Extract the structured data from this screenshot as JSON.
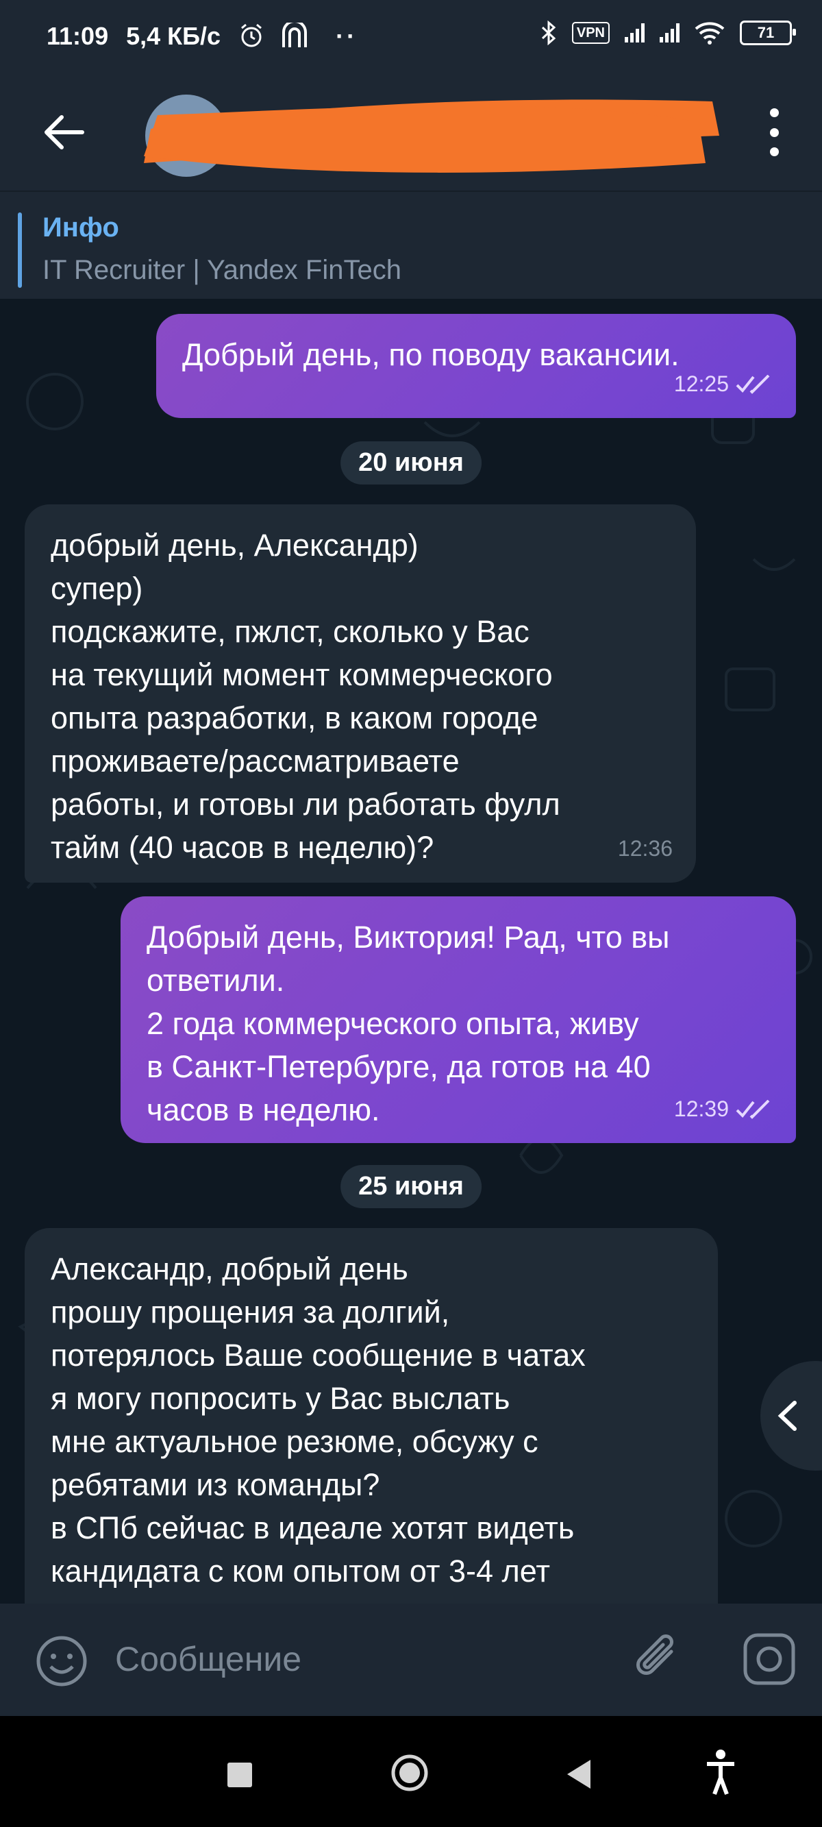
{
  "status_bar": {
    "time": "11:09",
    "speed": "5,4 КБ/с",
    "vpn": "VPN",
    "battery": "71"
  },
  "header": {
    "contact_name_redacted": ""
  },
  "pinned": {
    "title": "Инфо",
    "subtitle": "IT Recruiter | Yandex FinTech"
  },
  "messages": [
    {
      "type": "out",
      "text": "Добрый день, по поводу вакансии.",
      "time": "12:25"
    },
    {
      "type": "date",
      "text": "20 июня"
    },
    {
      "type": "in",
      "text": "добрый день, Александр)\nсупер)\nподскажите, пжлст, сколько у Вас\nна текущий момент коммерческого\nопыта разработки, в каком городе\nпроживаете/рассматриваете\nработы, и готовы ли работать фулл\nтайм (40 часов в неделю)?",
      "time": "12:36"
    },
    {
      "type": "out",
      "text": "Добрый день, Виктория! Рад, что вы\nответили.\n2 года коммерческого опыта, живу\nв Санкт-Петербурге, да готов на 40\nчасов в неделю.",
      "time": "12:39"
    },
    {
      "type": "date",
      "text": "25 июня"
    },
    {
      "type": "in",
      "text": "Александр, добрый день\nпрошу прощения за долгий,\nпотерялось Ваше сообщение в чатах\nя могу попросить у Вас выслать\nмне актуальное резюме, обсужу с\nребятами из команды?\nв СПб сейчас в идеале хотят видеть\nкандидата с ком опытом от 3-4 лет",
      "time": ""
    }
  ],
  "composer": {
    "placeholder": "Сообщение"
  },
  "colors": {
    "out_bubble": "#7a46cf",
    "in_bubble": "#1f2a35",
    "accent": "#6ab2f2",
    "redaction": "#f4752a"
  }
}
